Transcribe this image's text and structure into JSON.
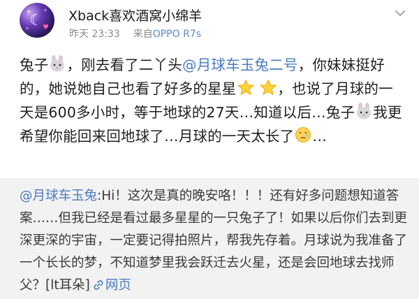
{
  "post": {
    "username": "Xback喜欢酒窝小绵羊",
    "time": "昨天 23:33",
    "source_prefix": "来自",
    "device": "OPPO R7s",
    "text_1": "兔子",
    "text_2": "，刚去看了二丫头",
    "mention": "@月球车玉兔二号",
    "text_3": "，你妹妹挺好的，她说她自己也看了好多的星星",
    "text_4": "，也说了月球的一天是600多小时，等于地球的27天…知道以后…兔子",
    "text_5": "我更希望你能回来回地球了…月球的一天太长了",
    "text_6": "…"
  },
  "quote": {
    "mention": "@月球车玉兔",
    "text": ":Hi！这次是真的晚安咯！！！还有好多问题想知道答案……但我已经是看过最多星星的一只兔子了！如果以后你们去到更深更深的宇宙，一定要记得拍照片，帮我先存着。月球说为我准备了一个长长的梦，不知道梦里我会跃迁去火星，还是会回地球去找师父？[lt耳朵]",
    "link_label": "网页"
  },
  "icons": {
    "avatar": "avatar",
    "more": "chevron-down-icon",
    "rabbit": "rabbit-face-emoji",
    "star": "star-emoji",
    "sad": "sad-face-emoji",
    "link": "link-icon"
  },
  "colors": {
    "mention": "#4a7bc0",
    "quote_background": "#f2f2f2",
    "meta": "#8a8a8a"
  }
}
